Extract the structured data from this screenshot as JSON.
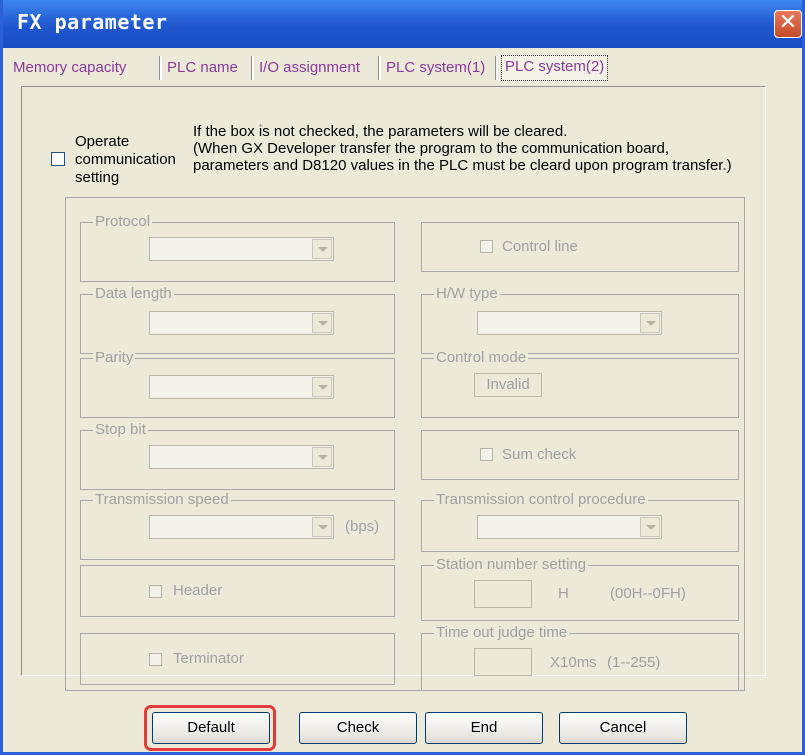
{
  "window": {
    "title": "FX parameter"
  },
  "tabs": [
    "Memory capacity",
    "PLC name",
    "I/O assignment",
    "PLC system(1)",
    "PLC system(2)"
  ],
  "operate": {
    "label_line1": "Operate",
    "label_line2": "communication",
    "label_line3": "setting",
    "checked": false
  },
  "info": {
    "line1": "If the box is not checked, the parameters will be cleared.",
    "line2": "(When GX Developer transfer the program to the communication board,",
    "line3": "parameters and D8120 values in the PLC must be cleard upon program transfer.)"
  },
  "left": {
    "protocol": "Protocol",
    "data_length": "Data length",
    "parity": "Parity",
    "stop_bit": "Stop bit",
    "transmission_speed": "Transmission speed",
    "bps": "(bps)",
    "header": "Header",
    "terminator": "Terminator"
  },
  "right": {
    "control_line": "Control line",
    "hw_type": "H/W type",
    "control_mode": "Control mode",
    "invalid": "Invalid",
    "sum_check": "Sum check",
    "transmission_control": "Transmission control procedure",
    "station_number": "Station number setting",
    "station_unit": "H",
    "station_range": "(00H--0FH)",
    "timeout": "Time out judge time",
    "timeout_unit": "X10ms",
    "timeout_range": "(1--255)"
  },
  "buttons": {
    "default": "Default",
    "check": "Check",
    "end": "End",
    "cancel": "Cancel"
  },
  "colors": {
    "titlebar": "#1f56cf",
    "highlight": "#e23b3b",
    "tab_text": "#8a3a9a"
  }
}
